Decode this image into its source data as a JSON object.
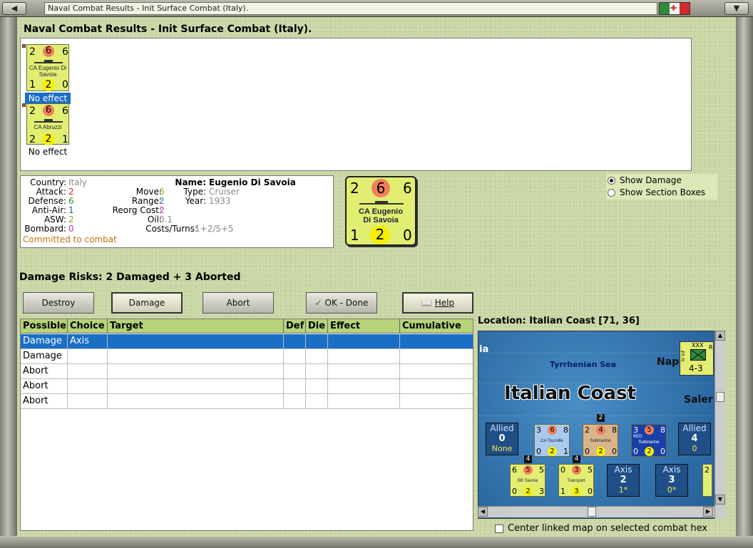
{
  "window": {
    "title": "Naval Combat Results - Init Surface Combat (Italy).",
    "heading": "Naval Combat Results - Init Surface Combat (Italy)."
  },
  "units": [
    {
      "name": "CA Eugenio Di Savoia",
      "top_left": "2",
      "top_mid": "6",
      "top_right": "6",
      "bot_left": "1",
      "bot_mid": "2",
      "bot_right": "0",
      "status": "No effect",
      "selected": true
    },
    {
      "name": "CA Abruzzi",
      "top_left": "2",
      "top_mid": "6",
      "top_right": "6",
      "bot_left": "2",
      "bot_mid": "2",
      "bot_right": "1",
      "status": "No effect",
      "selected": false
    }
  ],
  "info": {
    "country_label": "Country:",
    "country": "Italy",
    "attack_label": "Attack:",
    "attack": "2",
    "defense_label": "Defense:",
    "defense": "6",
    "antiair_label": "Anti-Air:",
    "antiair": "1",
    "asw_label": "ASW:",
    "asw": "2",
    "bombard_label": "Bombard:",
    "bombard": "0",
    "move_label": "Move:",
    "move": "6",
    "range_label": "Range:",
    "range": "2",
    "reorg_label": "Reorg Cost:",
    "reorg": "2",
    "oil_label": "Oil:",
    "oil": "0.1",
    "costs_label": "Costs/Turns:",
    "costs": "1+2/5+5",
    "name_label": "Name:",
    "name": "Eugenio Di Savoia",
    "type_label": "Type:",
    "type": "Cruiser",
    "year_label": "Year:",
    "year": "1933",
    "status": "Committed to combat"
  },
  "big_counter": {
    "name_line1": "CA Eugenio",
    "name_line2": "Di Savoia",
    "top_left": "2",
    "top_mid": "6",
    "top_right": "6",
    "bot_left": "1",
    "bot_mid": "2",
    "bot_right": "0"
  },
  "radios": {
    "show_damage": "Show Damage",
    "show_section_boxes": "Show Section Boxes"
  },
  "damage_risks": "Damage Risks:  2 Damaged + 3 Aborted",
  "buttons": {
    "destroy": "Destroy",
    "damage": "Damage",
    "abort": "Abort",
    "ok": "OK - Done",
    "help": "Help"
  },
  "table": {
    "headers": [
      "Possible",
      "Choice",
      "Target",
      "Def",
      "Die",
      "Effect",
      "Cumulative"
    ],
    "rows": [
      [
        "Damage",
        "Axis",
        "",
        "",
        "",
        "",
        ""
      ],
      [
        "Damage",
        "",
        "",
        "",
        "",
        "",
        ""
      ],
      [
        "Abort",
        "",
        "",
        "",
        "",
        "",
        ""
      ],
      [
        "Abort",
        "",
        "",
        "",
        "",
        "",
        ""
      ],
      [
        "Abort",
        "",
        "",
        "",
        "",
        "",
        ""
      ]
    ]
  },
  "location": "Location:  Italian Coast [71, 36]",
  "map": {
    "region_title": "Italian Coast",
    "sea_label": "Tyrrhenian Sea",
    "place_left": "ia",
    "place_napl": "Napl",
    "place_saler": "Saler",
    "corps_counter": {
      "top_left": "IV Inf",
      "top": "XXX",
      "top_right": "R",
      "strength": "4-3"
    },
    "allied_left": {
      "label": "Allied",
      "value": "0",
      "sub": "None"
    },
    "allied_right": {
      "label": "Allied",
      "value": "4",
      "sub": "0"
    },
    "axis_mid": {
      "label": "Axis",
      "value": "2",
      "sub": "1*"
    },
    "axis_right": {
      "label": "Axis",
      "value": "3",
      "sub": "0*"
    },
    "tourville": {
      "name": "CA Tourville",
      "tl": "3",
      "tm": "6",
      "tr": "8",
      "bl": "0",
      "bm": "2",
      "br": "1"
    },
    "submarine1": {
      "name": "Submarine",
      "tl": "2",
      "tm": "4",
      "tr": "8",
      "bl": "0",
      "bm": "2",
      "br": "0",
      "stack": "2"
    },
    "submarine2": {
      "name": "Submarine",
      "tag": "RED",
      "tl": "3",
      "tm": "5",
      "tr": "8",
      "bl": "0",
      "bm": "2",
      "br": "0"
    },
    "bbsavoia": {
      "name": "BB Savoia",
      "tl": "6",
      "tm": "5",
      "tr": "5",
      "bl": "0",
      "bm": "2",
      "br": "3",
      "stack": "4"
    },
    "transport": {
      "name": "Transport",
      "tl": "0",
      "tm": "3",
      "tr": "5",
      "bl": "1",
      "bm": "3",
      "br": "0",
      "stack": "4"
    },
    "edge_digit": "2"
  },
  "center_checkbox": "Center linked map on selected combat hex"
}
